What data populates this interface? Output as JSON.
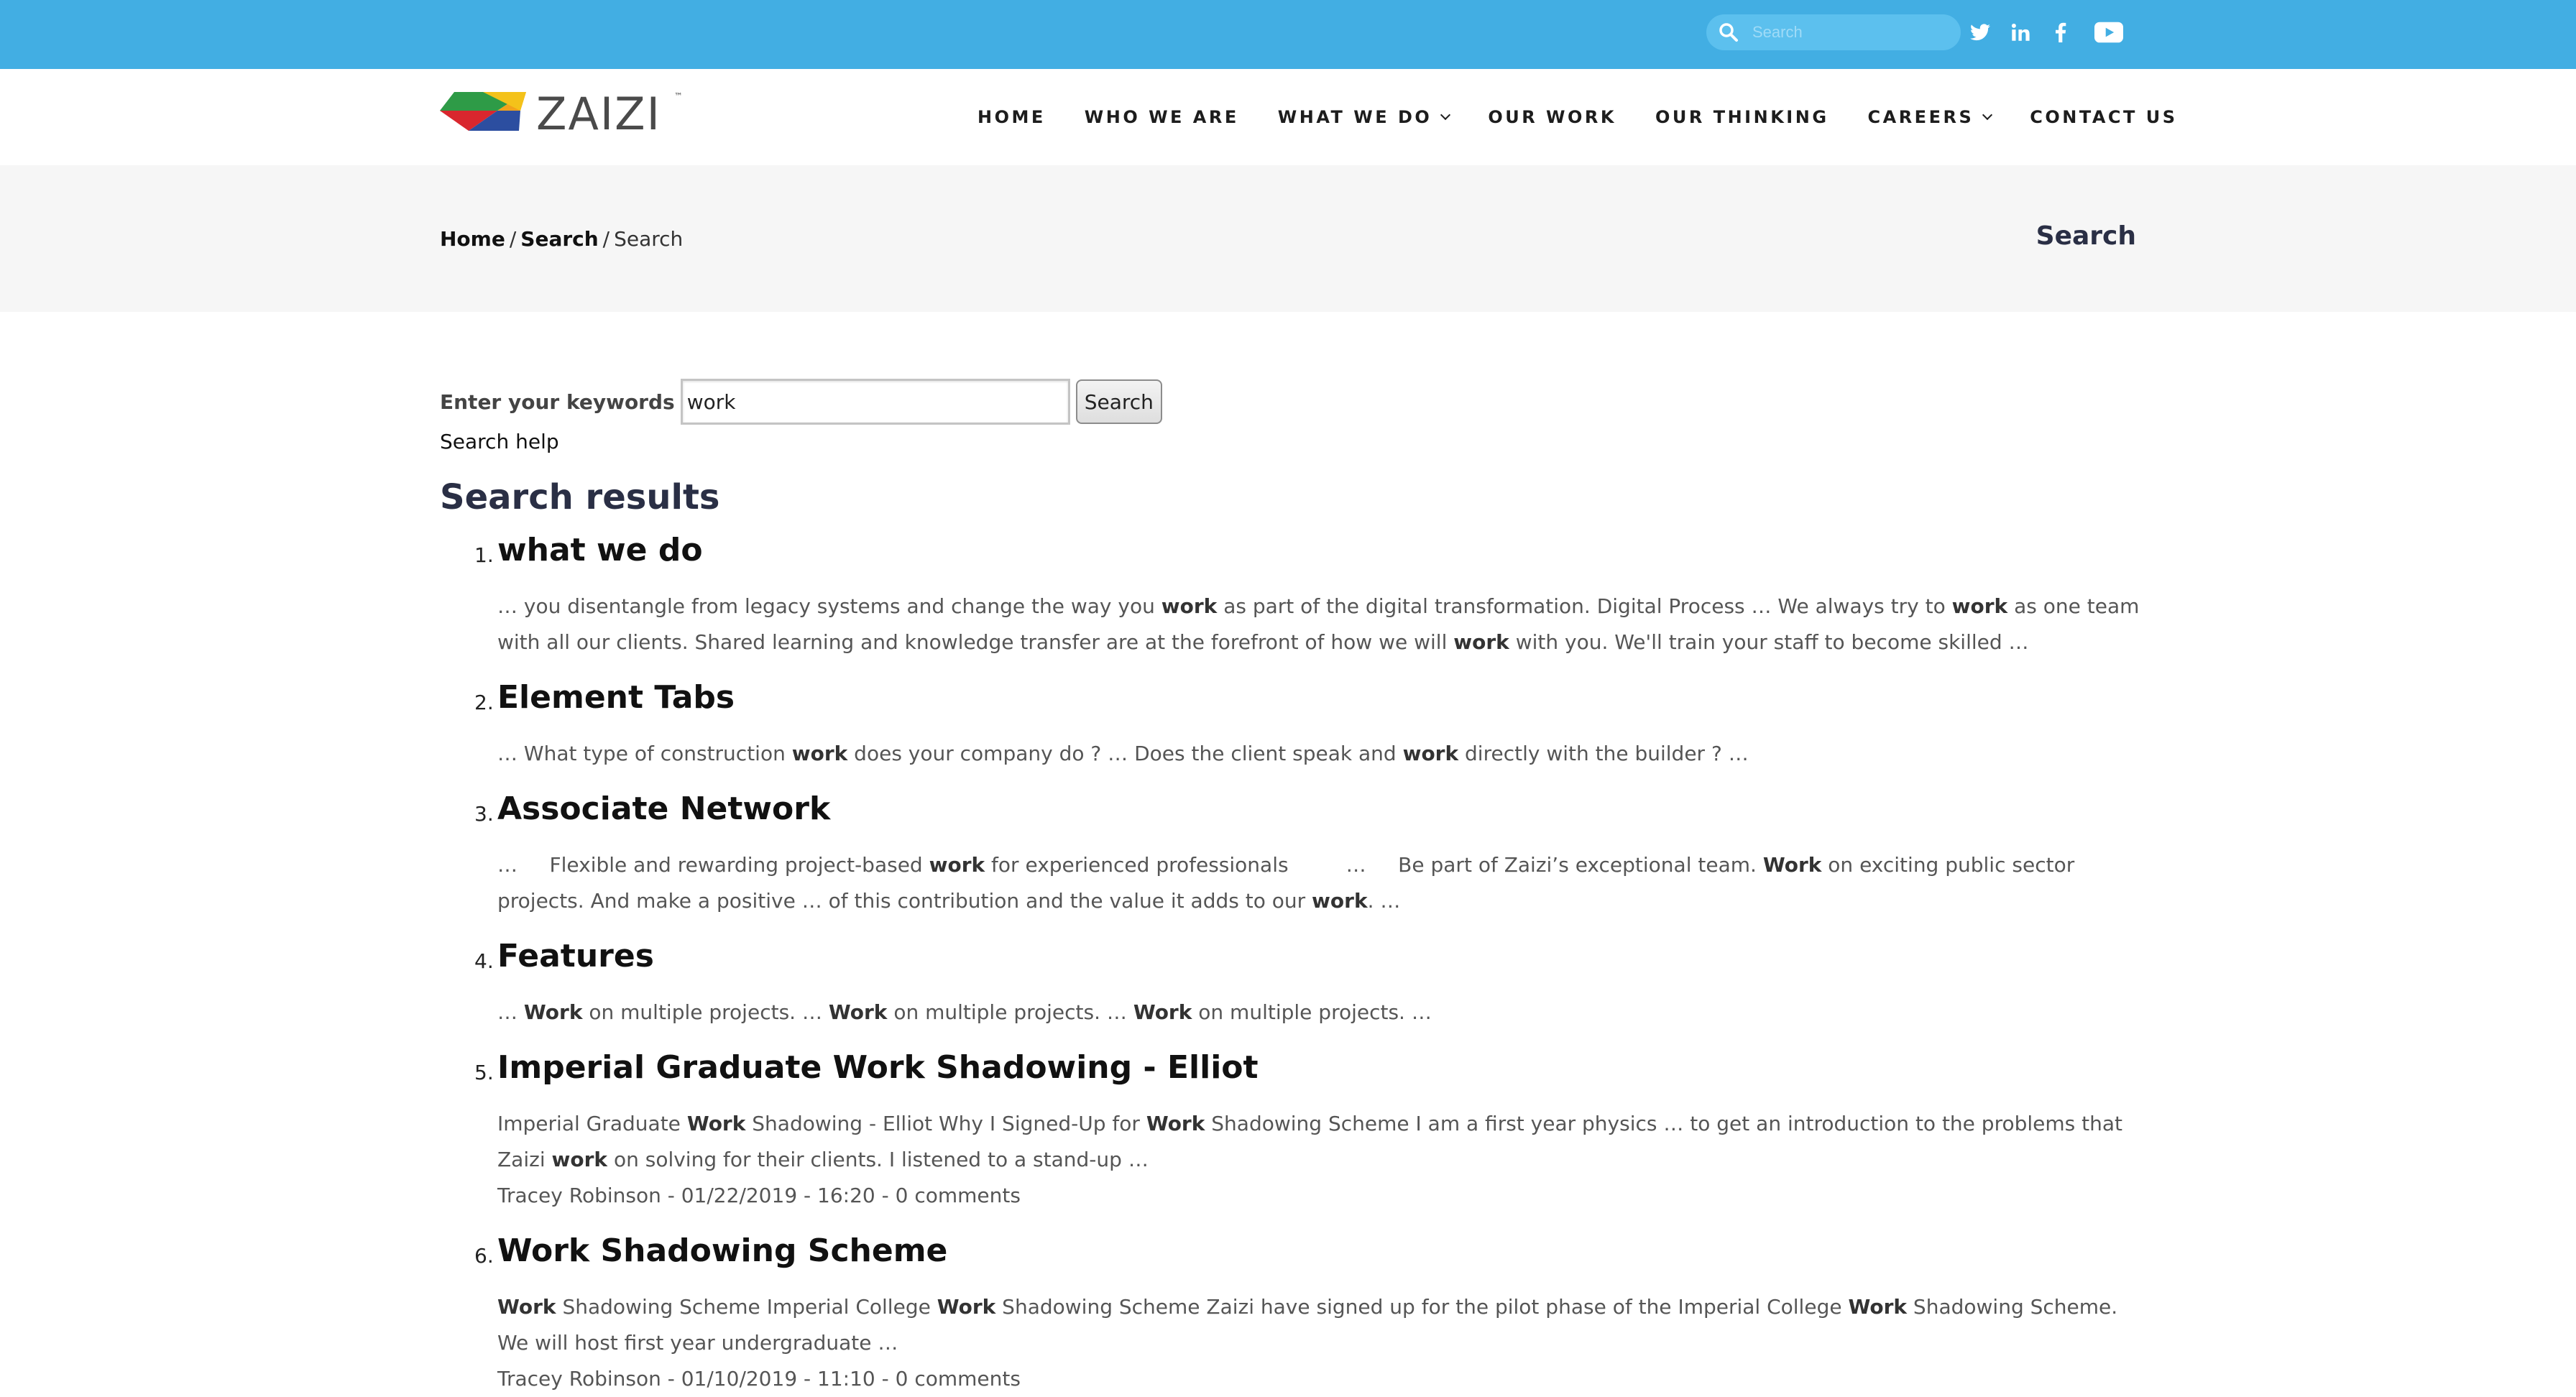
{
  "topbar": {
    "search_placeholder": "Search",
    "search_icon": "search-icon",
    "social": [
      "twitter-icon",
      "linkedin-icon",
      "facebook-icon",
      "youtube-icon"
    ],
    "color": "#42aee3"
  },
  "logo": {
    "text": "ZAIZI",
    "tm": "™"
  },
  "nav": {
    "items": [
      {
        "label": "HOME"
      },
      {
        "label": "WHO WE ARE"
      },
      {
        "label": "WHAT WE DO"
      },
      {
        "label": "OUR WORK"
      },
      {
        "label": "OUR THINKING"
      },
      {
        "label": "CAREERS"
      },
      {
        "label": "CONTACT US"
      }
    ]
  },
  "breadcrumb": {
    "home": "Home",
    "sep": "/",
    "search": "Search",
    "current": "Search"
  },
  "banner": {
    "title": "Search"
  },
  "search_form": {
    "label": "Enter your keywords",
    "value": "work",
    "button": "Search",
    "help": "Search help"
  },
  "results_heading": "Search results",
  "results": [
    {
      "num": "1.",
      "title": "what we do",
      "snippet": "… you disentangle from legacy systems and change the way you <b>work</b> as part of the digital transformation. Digital Process … We always try to <b>work</b> as one team with all our clients. Shared learning and knowledge transfer are at the forefront of how we will <b>work</b> with you. We'll train your staff to become skilled …",
      "meta": ""
    },
    {
      "num": "2.",
      "title": "Element Tabs",
      "snippet": "… What type of construction <b>work</b> does your company do ? … Does the client speak and <b>work</b> directly with the builder ? …",
      "meta": ""
    },
    {
      "num": "3.",
      "title": "Associate Network",
      "snippet": "…&nbsp;&nbsp;&nbsp;&nbsp; Flexible and rewarding project-based <b>work</b> for experienced professionals &nbsp;&nbsp;&nbsp;&nbsp;&nbsp;&nbsp;&nbsp; …&nbsp;&nbsp;&nbsp;&nbsp; Be part of Zaizi’s exceptional team. <b>Work</b> on exciting public sector projects. And make a positive … of this contribution and the value it adds to our <b>work</b>. …",
      "meta": ""
    },
    {
      "num": "4.",
      "title": "Features",
      "snippet": "… <b>Work</b> on multiple projects. … <b>Work</b> on multiple projects. … <b>Work</b> on multiple projects. …",
      "meta": ""
    },
    {
      "num": "5.",
      "title": "Imperial Graduate Work Shadowing - Elliot",
      "snippet": "Imperial Graduate <b>Work</b> Shadowing - Elliot Why I Signed-Up for <b>Work</b> Shadowing Scheme I am a first year physics … to get an introduction to the problems that Zaizi <b>work</b> on solving for their clients. I listened to a stand-up …",
      "meta": "Tracey Robinson - 01/22/2019 - 16:20 - 0 comments"
    },
    {
      "num": "6.",
      "title": "Work Shadowing Scheme",
      "snippet": "<b>Work</b> Shadowing Scheme Imperial College <b>Work</b> Shadowing Scheme Zaizi have signed up for the pilot phase of the Imperial College <b>Work</b> Shadowing Scheme. We will host first year undergraduate …",
      "meta": "Tracey Robinson - 01/10/2019 - 11:10 - 0 comments"
    }
  ]
}
